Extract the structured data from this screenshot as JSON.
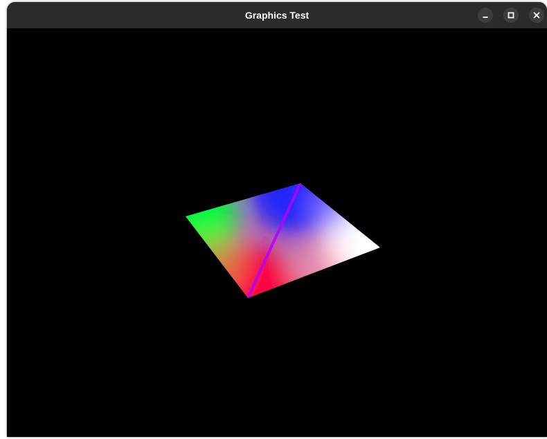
{
  "window": {
    "title": "Graphics Test"
  },
  "controls": {
    "minimize_icon": "minimize-icon",
    "maximize_icon": "maximize-icon",
    "close_icon": "close-icon"
  },
  "scene": {
    "vertex_colors": {
      "left": "#00ff00",
      "top": "#0000ff",
      "right": "#ffffff",
      "bottom": "#ff0000"
    }
  }
}
